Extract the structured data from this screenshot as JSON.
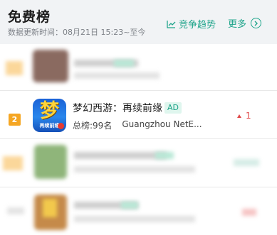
{
  "header": {
    "title": "免费榜",
    "update_text": "数据更新时间：08月21日 15:23~至今",
    "trend_label": "竞争趋势",
    "more_label": "更多"
  },
  "featured_row": {
    "rank": "2",
    "icon_glyph": "梦",
    "icon_subtitle": "再续前缘",
    "app_name": "梦幻西游：再续前缘",
    "ad_label": "AD",
    "overall_rank": "总榜:99名",
    "developer": "Guangzhou NetE...",
    "change_value": "1"
  },
  "colors": {
    "accent": "#1ea48a",
    "rank_badge": "#f5a623",
    "increase": "#e04848"
  }
}
